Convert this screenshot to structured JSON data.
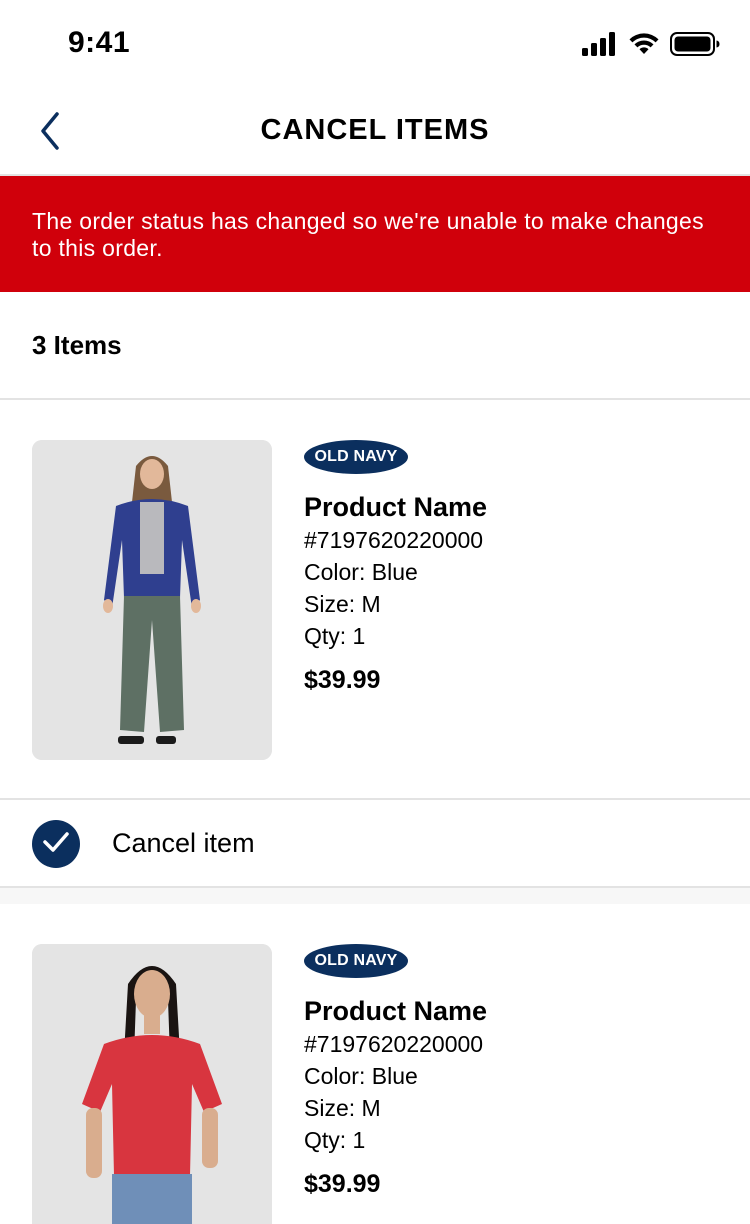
{
  "status_bar": {
    "time": "9:41",
    "icons": [
      "cellular-signal-icon",
      "wifi-icon",
      "battery-icon"
    ]
  },
  "header": {
    "back_icon": "chevron-left-icon",
    "title": "CANCEL ITEMS"
  },
  "alert": {
    "message": "The order status has changed so we're unable to make changes to this order.",
    "background_color": "#d0000b"
  },
  "items_count": "3 Items",
  "products": [
    {
      "brand": "OLD NAVY",
      "name": "Product Name",
      "sku": "#7197620220000",
      "color": "Color: Blue",
      "size": "Size: M",
      "qty": "Qty: 1",
      "price": "$39.99",
      "cancel_label": "Cancel item",
      "cancel_checked": true
    },
    {
      "brand": "OLD NAVY",
      "name": "Product Name",
      "sku": "#7197620220000",
      "color": "Color: Blue",
      "size": "Size: M",
      "qty": "Qty: 1",
      "price": "$39.99"
    }
  ],
  "colors": {
    "brand_navy": "#0b2f5e",
    "alert_red": "#d0000b"
  }
}
